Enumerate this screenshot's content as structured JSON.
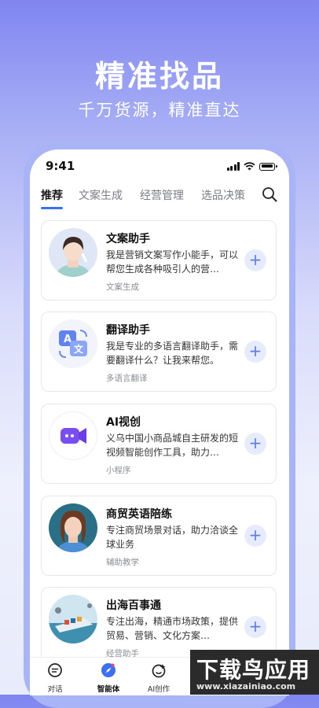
{
  "hero": {
    "title": "精准找品",
    "subtitle": "千万货源，精准直达"
  },
  "status_bar": {
    "time": "9:41"
  },
  "tabs": [
    {
      "label": "推荐",
      "active": true
    },
    {
      "label": "文案生成",
      "active": false
    },
    {
      "label": "经营管理",
      "active": false
    },
    {
      "label": "选品决策",
      "active": false
    }
  ],
  "cards": [
    {
      "title": "文案助手",
      "desc": "我是营销文案写作小能手，可以帮您生成各种吸引人的营…",
      "tag": "文案生成",
      "add": "+"
    },
    {
      "title": "翻译助手",
      "desc": "我是专业的多语言翻译助手，需要翻译什么？让我来帮您。",
      "tag": "多语言翻译",
      "add": "+"
    },
    {
      "title": "AI视创",
      "desc": "义乌中国小商品城自主研发的短视频智能创作工具，助力…",
      "tag": "小程序",
      "add": "+"
    },
    {
      "title": "商贸英语陪练",
      "desc": "专注商贸场景对话，助力洽谈全球业务",
      "tag": "辅助教学",
      "add": "+"
    },
    {
      "title": "出海百事通",
      "desc": "专注出海，精通市场政策，提供贸易、营销、文化方案…",
      "tag": "经营助手",
      "add": "+"
    }
  ],
  "bottom_nav": [
    {
      "label": "对话",
      "icon": "chat-icon",
      "active": false
    },
    {
      "label": "智能体",
      "icon": "compass-icon",
      "active": true
    },
    {
      "label": "AI创作",
      "icon": "ai-create-icon",
      "active": false
    }
  ],
  "watermark": {
    "text": "下载鸟应用",
    "url": "www.xiazainiao.com"
  },
  "colors": {
    "accent": "#3b6ff5",
    "add_button_bg": "#e6ecfd",
    "hero_gradient_top": "#7f86f0"
  }
}
